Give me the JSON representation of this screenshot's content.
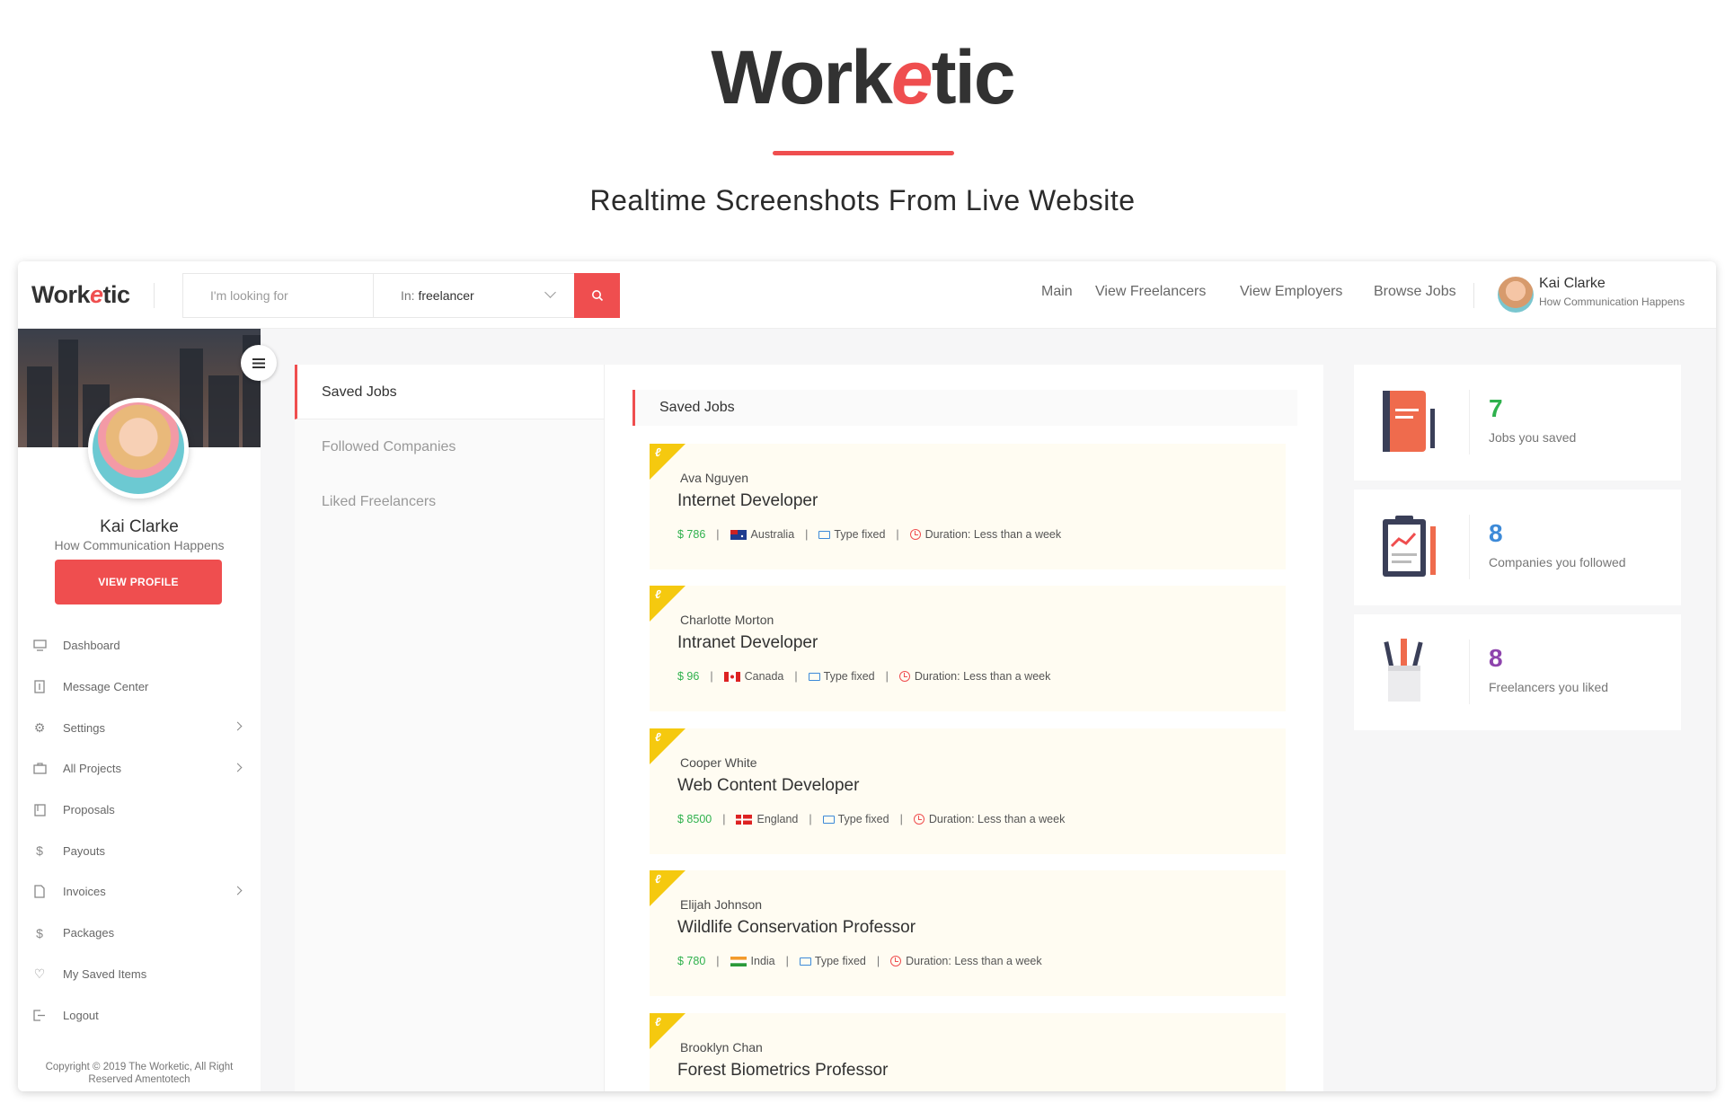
{
  "promo": {
    "brand_pre": "Work",
    "brand_mid": "e",
    "brand_post": "tic",
    "tagline": "Realtime Screenshots From Live Website"
  },
  "header": {
    "logo_pre": "Work",
    "logo_mid": "e",
    "logo_post": "tic",
    "search_placeholder": "I'm looking for",
    "search_in_label": "In:",
    "search_in_value": "freelancer",
    "nav": [
      "Main",
      "View Freelancers",
      "View Employers",
      "Browse Jobs"
    ],
    "user_name": "Kai Clarke",
    "user_tagline": "How Communication Happens"
  },
  "sidebar": {
    "name": "Kai Clarke",
    "tagline": "How Communication Happens",
    "view_profile": "VIEW PROFILE",
    "items": [
      {
        "label": "Dashboard",
        "icon": "monitor-icon",
        "submenu": false
      },
      {
        "label": "Message Center",
        "icon": "building-icon",
        "submenu": false
      },
      {
        "label": "Settings",
        "icon": "gear-icon",
        "submenu": true
      },
      {
        "label": "All Projects",
        "icon": "briefcase-icon",
        "submenu": true
      },
      {
        "label": "Proposals",
        "icon": "document-icon",
        "submenu": false
      },
      {
        "label": "Payouts",
        "icon": "dollar-icon",
        "submenu": false
      },
      {
        "label": "Invoices",
        "icon": "file-icon",
        "submenu": true
      },
      {
        "label": "Packages",
        "icon": "dollar-icon",
        "submenu": false
      },
      {
        "label": "My Saved Items",
        "icon": "heart-icon",
        "submenu": false
      },
      {
        "label": "Logout",
        "icon": "logout-icon",
        "submenu": false
      }
    ],
    "copyright_1": "Copyright © 2019 The Worketic, All Right",
    "copyright_2": "Reserved Amentotech"
  },
  "tabs": [
    "Saved Jobs",
    "Followed Companies",
    "Liked Freelancers"
  ],
  "content": {
    "heading": "Saved Jobs",
    "jobs": [
      {
        "employer": "Ava Nguyen",
        "title": "Internet Developer",
        "price": "$ 786",
        "country": "Australia",
        "type": "Type fixed",
        "duration": "Duration: Less than a week"
      },
      {
        "employer": "Charlotte Morton",
        "title": "Intranet Developer",
        "price": "$ 96",
        "country": "Canada",
        "type": "Type fixed",
        "duration": "Duration: Less than a week"
      },
      {
        "employer": "Cooper White",
        "title": "Web Content Developer",
        "price": "$ 8500",
        "country": "England",
        "type": "Type fixed",
        "duration": "Duration: Less than a week"
      },
      {
        "employer": "Elijah Johnson",
        "title": "Wildlife Conservation Professor",
        "price": "$ 780",
        "country": "India",
        "type": "Type fixed",
        "duration": "Duration: Less than a week"
      },
      {
        "employer": "Brooklyn Chan",
        "title": "Forest Biometrics Professor",
        "price": "",
        "country": "",
        "type": "",
        "duration": ""
      }
    ]
  },
  "stats": [
    {
      "value": "7",
      "label": "Jobs you saved",
      "color": "#2fb14d",
      "icon": "notebook-icon"
    },
    {
      "value": "8",
      "label": "Companies you followed",
      "color": "#3d8ad8",
      "icon": "clipboard-chart-icon"
    },
    {
      "value": "8",
      "label": "Freelancers you liked",
      "color": "#8e44ad",
      "icon": "pencil-cup-icon"
    }
  ],
  "colors": {
    "accent": "#ef4e4f",
    "ribbon": "#f5c90f"
  }
}
